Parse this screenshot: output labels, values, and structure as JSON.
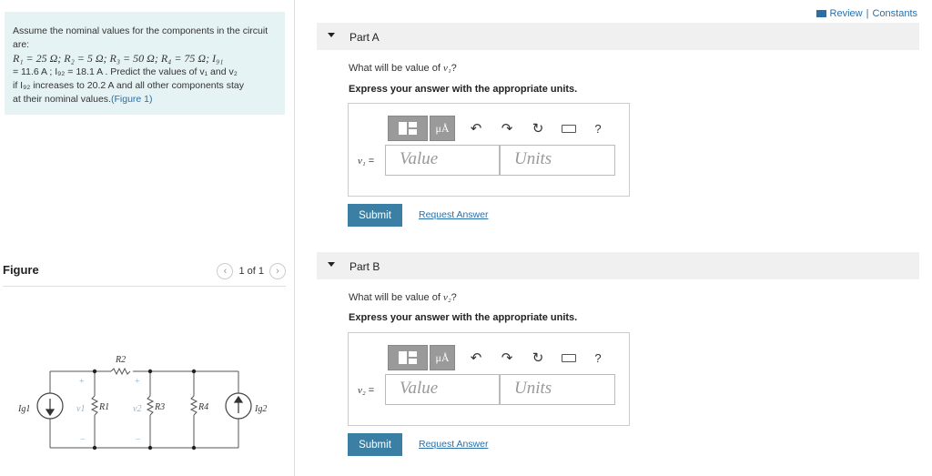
{
  "problem": {
    "intro": "Assume the nominal values for the components in the circuit are:",
    "values_line": "R₁ = 25 Ω; R₂ = 5 Ω; R₃ = 50 Ω; R₄ = 75 Ω; I₉₁",
    "line2": "= 11.6 A ; I₉₂ = 18.1 A . Predict the values of v₁ and v₂",
    "line3": "if I₉₂ increases to 20.2 A and all other components stay",
    "line4": "at their nominal values.",
    "figure_link": "(Figure 1)"
  },
  "figure": {
    "title": "Figure",
    "pager": "1 of 1",
    "prev_icon": "chevron-left-icon",
    "next_icon": "chevron-right-icon",
    "labels": {
      "ig1": "Ig1",
      "ig2": "Ig2",
      "r1": "R1",
      "r2": "R2",
      "r3": "R3",
      "r4": "R4",
      "v1": "v1",
      "v2": "v2",
      "plus": "+",
      "minus": "−"
    }
  },
  "header": {
    "review": "Review",
    "sep": "|",
    "constants": "Constants"
  },
  "parts": [
    {
      "label": "Part A",
      "question_pre": "What will be value of ",
      "question_var": "v₁",
      "question_post": "?",
      "instruction": "Express your answer with the appropriate units.",
      "var_label": "v₁",
      "eq": "=",
      "value_placeholder": "Value",
      "units_placeholder": "Units",
      "submit": "Submit",
      "request": "Request Answer"
    },
    {
      "label": "Part B",
      "question_pre": "What will be value of ",
      "question_var": "v₂",
      "question_post": "?",
      "instruction": "Express your answer with the appropriate units.",
      "var_label": "v₂",
      "eq": "=",
      "value_placeholder": "Value",
      "units_placeholder": "Units",
      "submit": "Submit",
      "request": "Request Answer"
    }
  ],
  "toolbar": {
    "mu": "μÅ",
    "undo": "↶",
    "redo": "↷",
    "reset": "↻",
    "help": "?"
  },
  "colors": {
    "accent": "#3c7fa5",
    "link": "#2a6fa8",
    "problem_bg": "#e6f3f5"
  }
}
